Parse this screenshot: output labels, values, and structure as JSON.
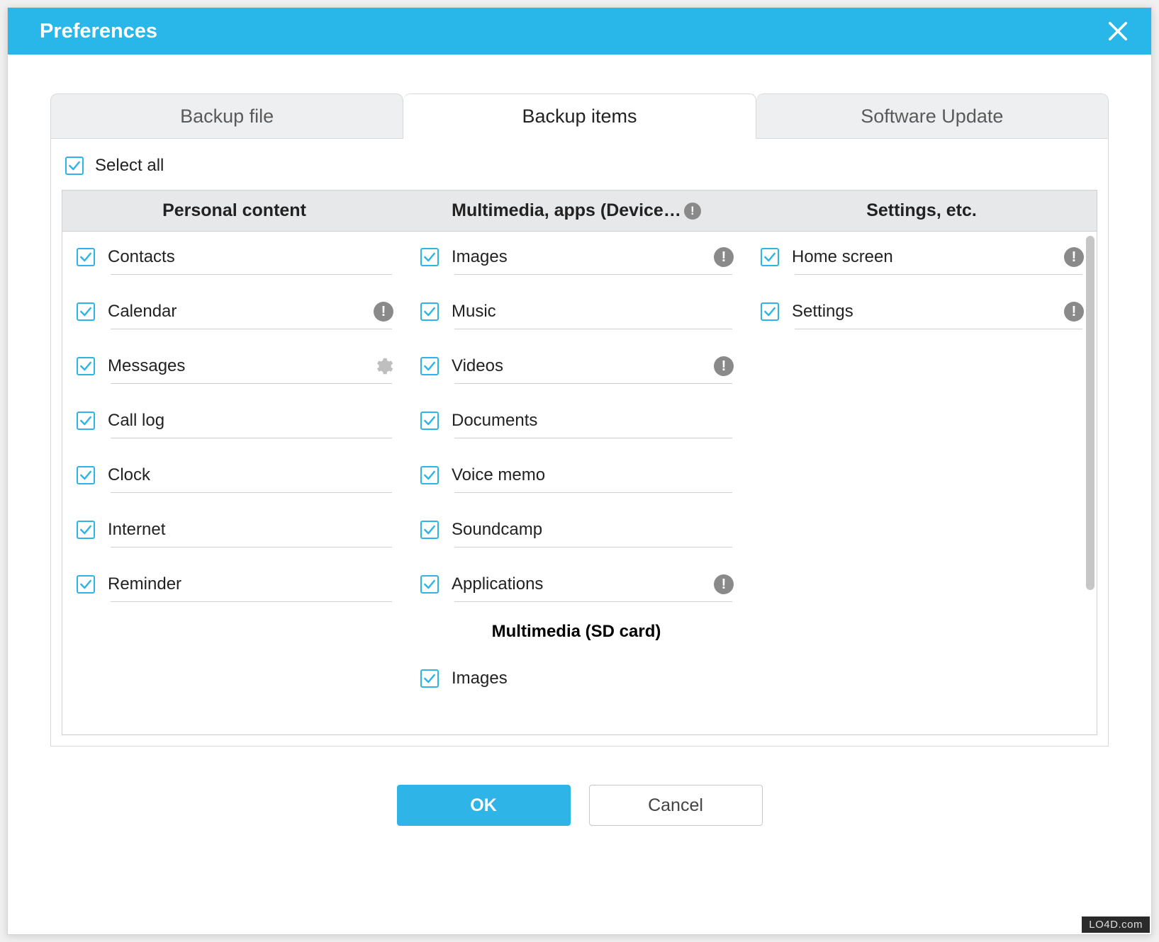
{
  "titlebar": {
    "title": "Preferences"
  },
  "tabs": {
    "backup_file": "Backup file",
    "backup_items": "Backup items",
    "software_update": "Software Update"
  },
  "select_all": "Select all",
  "columns": {
    "personal": "Personal content",
    "multimedia": "Multimedia, apps (Device…",
    "settings": "Settings, etc."
  },
  "personal_items": {
    "contacts": "Contacts",
    "calendar": "Calendar",
    "messages": "Messages",
    "call_log": "Call log",
    "clock": "Clock",
    "internet": "Internet",
    "reminder": "Reminder"
  },
  "multimedia_items": {
    "images": "Images",
    "music": "Music",
    "videos": "Videos",
    "documents": "Documents",
    "voice_memo": "Voice memo",
    "soundcamp": "Soundcamp",
    "applications": "Applications"
  },
  "multimedia_sd_header": "Multimedia (SD card)",
  "multimedia_sd_items": {
    "images": "Images"
  },
  "settings_items": {
    "home_screen": "Home screen",
    "settings": "Settings"
  },
  "buttons": {
    "ok": "OK",
    "cancel": "Cancel"
  },
  "watermark": "LO4D.com"
}
